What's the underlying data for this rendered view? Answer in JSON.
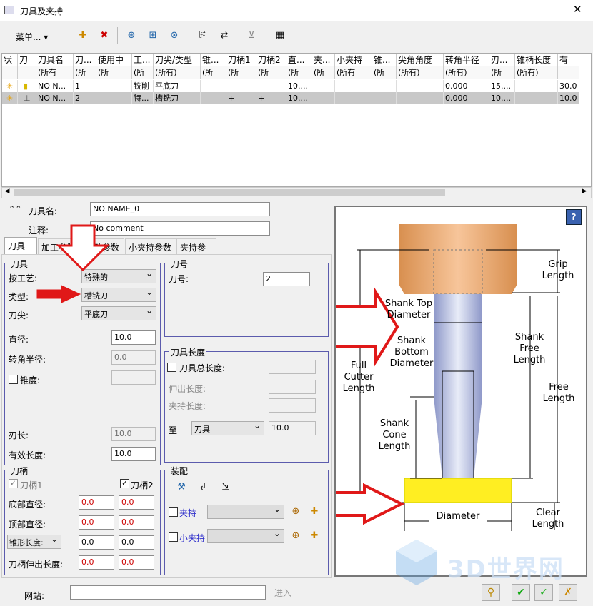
{
  "window": {
    "title": "刀具及夹持"
  },
  "toolbar": {
    "menu_label": "菜单..."
  },
  "table": {
    "headers": [
      "状",
      "刀",
      "刀具名",
      "刀...",
      "使用中",
      "工...",
      "刀尖/类型",
      "锥...",
      "刀柄1",
      "刀柄2",
      "直...",
      "夹...",
      "小夹持",
      "锥...",
      "尖角角度",
      "转角半径",
      "刃...",
      "锥柄长度",
      "有"
    ],
    "filters": [
      "",
      "",
      "(所有",
      "(所",
      "(所",
      "(所",
      "(所有)",
      "(所",
      "(所",
      "(所",
      "(所",
      "(所",
      "(所有",
      "(所",
      "(所有)",
      "(所有)",
      "(所",
      "(所有)",
      ""
    ],
    "rows": [
      [
        "",
        "",
        "NO N...",
        "1",
        "",
        "铣削",
        "平底刀",
        "",
        "",
        "",
        "10....",
        "",
        "",
        "",
        "",
        "0.000",
        "15....",
        "",
        "30.0"
      ],
      [
        "",
        "",
        "NO N...",
        "2",
        "",
        "特...",
        "槽铣刀",
        "",
        "+",
        "+",
        "10....",
        "",
        "",
        "",
        "",
        "0.000",
        "10....",
        "",
        "10.0"
      ]
    ]
  },
  "form": {
    "tool_name_label": "刀具名:",
    "tool_name_value": "NO NAME_0",
    "comment_label": "注释:",
    "comment_value": "No comment",
    "tabs": [
      "刀具",
      "加工参数",
      "运动参数",
      "小夹持参数",
      "夹持参数"
    ]
  },
  "tool_group": {
    "title": "刀具",
    "by_process_label": "按工艺:",
    "by_process_value": "特殊的",
    "type_label": "类型:",
    "type_value": "槽铣刀",
    "tip_label": "刀尖:",
    "tip_value": "平底刀",
    "diameter_label": "直径:",
    "diameter_value": "10.0",
    "corner_radius_label": "转角半径:",
    "corner_radius_value": "0.0",
    "taper_label": "锥度:",
    "flute_length_label": "刃长:",
    "flute_length_value": "10.0",
    "effective_length_label": "有效长度:",
    "effective_length_value": "10.0"
  },
  "tool_number_group": {
    "title": "刀号",
    "label": "刀号:",
    "value": "2"
  },
  "tool_length_group": {
    "title": "刀具长度",
    "total_length_label": "刀具总长度:",
    "extension_label": "伸出长度:",
    "holding_label": "夹持长度:",
    "to_label": "至",
    "to_value": "刀具",
    "to_number": "10.0"
  },
  "shank_group": {
    "title": "刀柄",
    "shank1_label": "刀柄1",
    "shank2_label": "刀柄2",
    "bottom_diameter_label": "底部直径:",
    "top_diameter_label": "顶部直径:",
    "cone_length_label": "锥形长度:",
    "extension_label": "刀柄伸出长度:",
    "values": [
      "0.0",
      "0.0",
      "0.0",
      "0.0",
      "0.0",
      "0.0",
      "0.0",
      "0.0"
    ]
  },
  "assembly_group": {
    "title": "装配",
    "holder_label": "夹持",
    "small_holder_label": "小夹持"
  },
  "website": {
    "label": "网站:",
    "go_label": "进入"
  },
  "diagram": {
    "labels": [
      "Grip Length",
      "Shank Top Diameter",
      "Shank Bottom Diameter",
      "Shank Free Length",
      "Full Cutter Length",
      "Free Length",
      "Shank Cone Length",
      "Diameter",
      "Clear Length"
    ],
    "help": "?"
  },
  "watermark": "3D世界网",
  "colors": {
    "holder": "#e8a66a",
    "cutter": "#ffee22",
    "shank": "#b8c3e3",
    "arrow": "#e01818"
  }
}
